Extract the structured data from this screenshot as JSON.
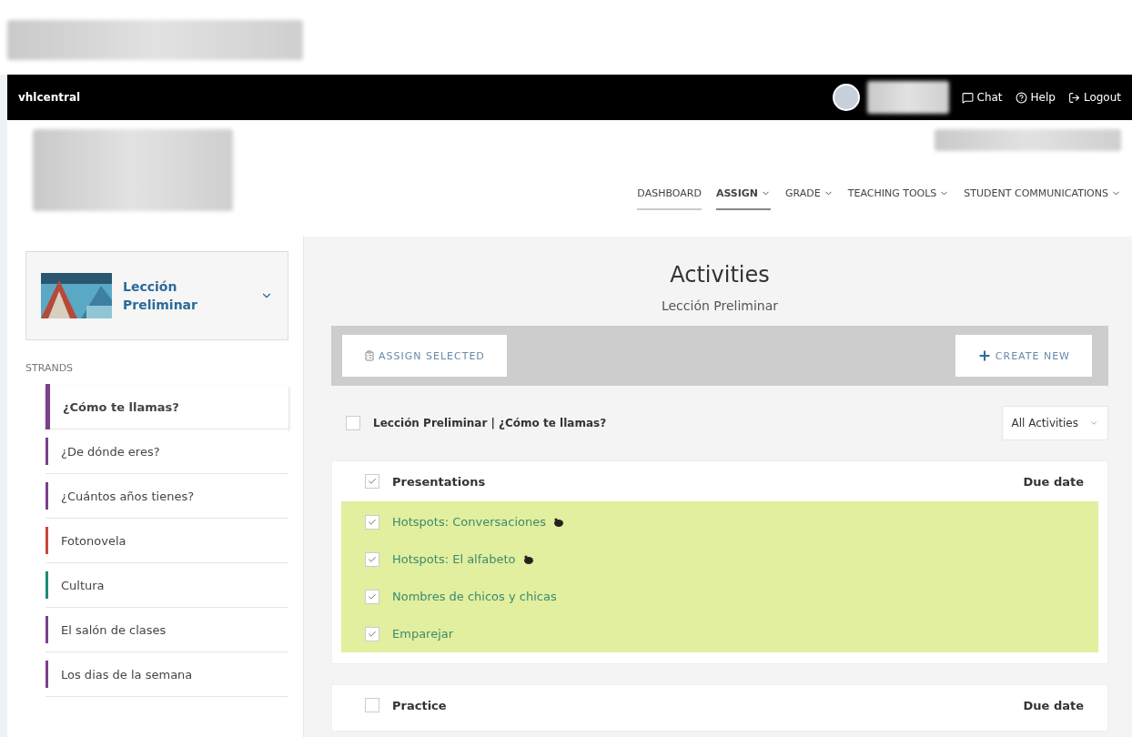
{
  "topbar": {
    "brand": "vhlcentral",
    "links": [
      {
        "kind": "chat",
        "label": "Chat"
      },
      {
        "kind": "help",
        "label": "Help"
      },
      {
        "kind": "logout",
        "label": "Logout"
      }
    ]
  },
  "nav": [
    {
      "label": "DASHBOARD",
      "selected": false,
      "underlined": true,
      "dropdown": false
    },
    {
      "label": "ASSIGN",
      "selected": true,
      "underlined": true,
      "dropdown": true
    },
    {
      "label": "GRADE",
      "selected": false,
      "underlined": false,
      "dropdown": true
    },
    {
      "label": "TEACHING TOOLS",
      "selected": false,
      "underlined": false,
      "dropdown": true
    },
    {
      "label": "STUDENT COMMUNICATIONS",
      "selected": false,
      "underlined": false,
      "dropdown": true
    }
  ],
  "sidebar": {
    "lesson": "Lección Preliminar",
    "section_label": "STRANDS",
    "strands": [
      {
        "label": "¿Cómo te llamas?",
        "selected": true,
        "color": "#7b3f8e"
      },
      {
        "label": "¿De dónde eres?",
        "selected": false,
        "color": "#7b3f8e"
      },
      {
        "label": "¿Cuántos años tienes?",
        "selected": false,
        "color": "#7b3f8e"
      },
      {
        "label": "Fotonovela",
        "selected": false,
        "color": "#c8473c"
      },
      {
        "label": "Cultura",
        "selected": false,
        "color": "#1f8a7a"
      },
      {
        "label": "El salón de clases",
        "selected": false,
        "color": "#7b3f8e"
      },
      {
        "label": "Los dias de la semana",
        "selected": false,
        "color": "#7b3f8e"
      }
    ]
  },
  "main": {
    "title": "Activities",
    "subtitle": "Lección Preliminar",
    "assign_button": "ASSIGN SELECTED",
    "create_button": "CREATE NEW",
    "breadcrumb": {
      "label": "Lección Preliminar | ¿Cómo te llamas?",
      "checked": false
    },
    "filter": "All Activities",
    "groups": [
      {
        "title": "Presentations",
        "due_header": "Due date",
        "checked": true,
        "activities": [
          {
            "label": "Hotspots: Conversaciones",
            "checked": true,
            "marker": true
          },
          {
            "label": "Hotspots: El alfabeto",
            "checked": true,
            "marker": true
          },
          {
            "label": "Nombres de chicos y chicas",
            "checked": true,
            "marker": false
          },
          {
            "label": "Emparejar",
            "checked": true,
            "marker": false
          }
        ]
      },
      {
        "title": "Practice",
        "due_header": "Due date",
        "checked": false
      }
    ]
  }
}
